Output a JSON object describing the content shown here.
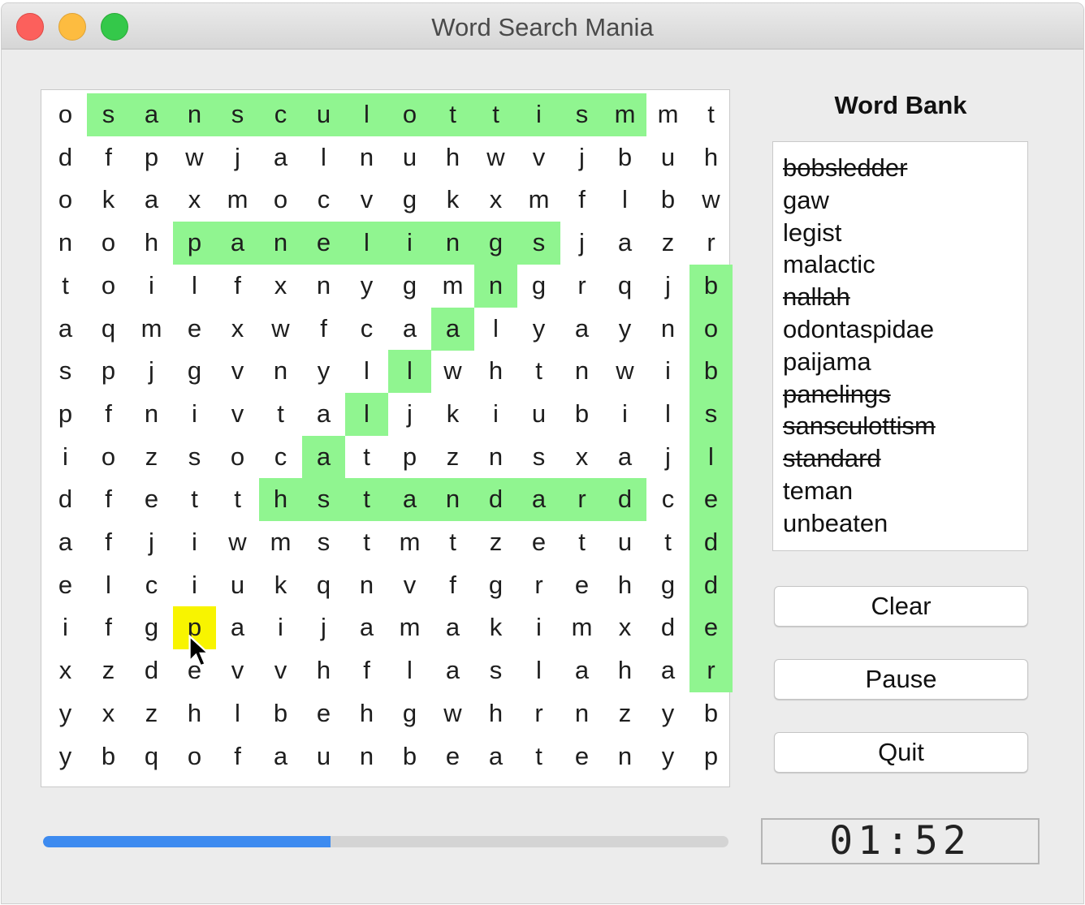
{
  "window": {
    "title": "Word Search Mania"
  },
  "grid": {
    "rows": [
      [
        "o",
        "s",
        "a",
        "n",
        "s",
        "c",
        "u",
        "l",
        "o",
        "t",
        "t",
        "i",
        "s",
        "m",
        "m",
        "t"
      ],
      [
        "d",
        "f",
        "p",
        "w",
        "j",
        "a",
        "l",
        "n",
        "u",
        "h",
        "w",
        "v",
        "j",
        "b",
        "u",
        "h"
      ],
      [
        "o",
        "k",
        "a",
        "x",
        "m",
        "o",
        "c",
        "v",
        "g",
        "k",
        "x",
        "m",
        "f",
        "l",
        "b",
        "w"
      ],
      [
        "n",
        "o",
        "h",
        "p",
        "a",
        "n",
        "e",
        "l",
        "i",
        "n",
        "g",
        "s",
        "j",
        "a",
        "z",
        "r"
      ],
      [
        "t",
        "o",
        "i",
        "l",
        "f",
        "x",
        "n",
        "y",
        "g",
        "m",
        "n",
        "g",
        "r",
        "q",
        "j",
        "b"
      ],
      [
        "a",
        "q",
        "m",
        "e",
        "x",
        "w",
        "f",
        "c",
        "a",
        "a",
        "l",
        "y",
        "a",
        "y",
        "n",
        "o"
      ],
      [
        "s",
        "p",
        "j",
        "g",
        "v",
        "n",
        "y",
        "l",
        "l",
        "w",
        "h",
        "t",
        "n",
        "w",
        "i",
        "b"
      ],
      [
        "p",
        "f",
        "n",
        "i",
        "v",
        "t",
        "a",
        "l",
        "j",
        "k",
        "i",
        "u",
        "b",
        "i",
        "l",
        "s"
      ],
      [
        "i",
        "o",
        "z",
        "s",
        "o",
        "c",
        "a",
        "t",
        "p",
        "z",
        "n",
        "s",
        "x",
        "a",
        "j",
        "l"
      ],
      [
        "d",
        "f",
        "e",
        "t",
        "t",
        "h",
        "s",
        "t",
        "a",
        "n",
        "d",
        "a",
        "r",
        "d",
        "c",
        "e"
      ],
      [
        "a",
        "f",
        "j",
        "i",
        "w",
        "m",
        "s",
        "t",
        "m",
        "t",
        "z",
        "e",
        "t",
        "u",
        "t",
        "d"
      ],
      [
        "e",
        "l",
        "c",
        "i",
        "u",
        "k",
        "q",
        "n",
        "v",
        "f",
        "g",
        "r",
        "e",
        "h",
        "g",
        "d"
      ],
      [
        "i",
        "f",
        "g",
        "p",
        "a",
        "i",
        "j",
        "a",
        "m",
        "a",
        "k",
        "i",
        "m",
        "x",
        "d",
        "e"
      ],
      [
        "x",
        "z",
        "d",
        "e",
        "v",
        "v",
        "h",
        "f",
        "l",
        "a",
        "s",
        "l",
        "a",
        "h",
        "a",
        "r"
      ],
      [
        "y",
        "x",
        "z",
        "h",
        "l",
        "b",
        "e",
        "h",
        "g",
        "w",
        "h",
        "r",
        "n",
        "z",
        "y",
        "b"
      ],
      [
        "y",
        "b",
        "q",
        "o",
        "f",
        "a",
        "u",
        "n",
        "b",
        "e",
        "a",
        "t",
        "e",
        "n",
        "y",
        "p"
      ]
    ],
    "found_highlights": [
      {
        "word": "sansculottism",
        "row_start": 0,
        "col_start": 1,
        "row_end": 0,
        "col_end": 13
      },
      {
        "word": "panelings",
        "row_start": 3,
        "col_start": 3,
        "row_end": 3,
        "col_end": 11
      },
      {
        "word": "nallah",
        "row_start": 4,
        "col_start": 10,
        "row_end": 9,
        "col_end": 5
      },
      {
        "word": "standard",
        "row_start": 9,
        "col_start": 6,
        "row_end": 9,
        "col_end": 13
      },
      {
        "word": "bobsledder",
        "row_start": 4,
        "col_start": 15,
        "row_end": 13,
        "col_end": 15
      }
    ],
    "selection": {
      "row": 12,
      "col": 3
    },
    "highlight_color": "#90f590",
    "selection_color": "#f8f400"
  },
  "word_bank": {
    "title": "Word Bank",
    "words": [
      {
        "text": "bobsledder",
        "found": true
      },
      {
        "text": "gaw",
        "found": false
      },
      {
        "text": "legist",
        "found": false
      },
      {
        "text": "malactic",
        "found": false
      },
      {
        "text": "nallah",
        "found": true
      },
      {
        "text": "odontaspidae",
        "found": false
      },
      {
        "text": "paijama",
        "found": false
      },
      {
        "text": "panelings",
        "found": true
      },
      {
        "text": "sansculottism",
        "found": true
      },
      {
        "text": "standard",
        "found": true
      },
      {
        "text": "teman",
        "found": false
      },
      {
        "text": "unbeaten",
        "found": false
      }
    ]
  },
  "buttons": {
    "clear": "Clear",
    "pause": "Pause",
    "quit": "Quit"
  },
  "progress": {
    "fraction": 0.42,
    "color": "#3d8bf0"
  },
  "timer": {
    "value": "01:52"
  }
}
